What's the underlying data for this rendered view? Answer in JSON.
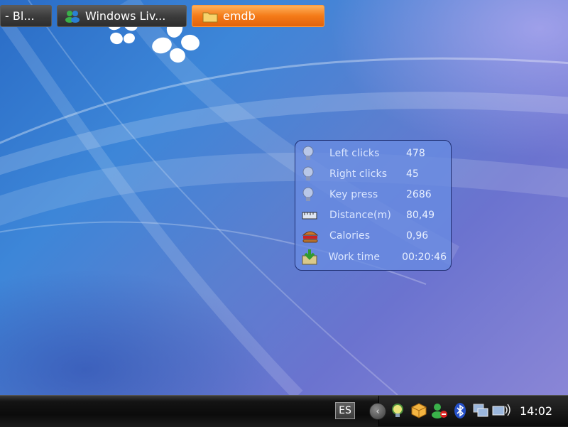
{
  "widget": {
    "rows": [
      {
        "label": "Left clicks",
        "value": "478",
        "icon": "mouse-bulb-icon"
      },
      {
        "label": "Right clicks",
        "value": "45",
        "icon": "mouse-bulb-icon"
      },
      {
        "label": "Key press",
        "value": "2686",
        "icon": "key-bulb-icon"
      },
      {
        "label": "Distance(m)",
        "value": "80,49",
        "icon": "ruler-icon"
      },
      {
        "label": "Calories",
        "value": "0,96",
        "icon": "burger-icon"
      },
      {
        "label": "Work time",
        "value": "00:20:46",
        "icon": "download-box-icon"
      }
    ]
  },
  "taskbar": {
    "tasks": [
      {
        "label": "- Bl...",
        "icon": "window-icon",
        "active": false
      },
      {
        "label": "Windows Liv...",
        "icon": "messenger-icon",
        "active": false
      },
      {
        "label": "emdb",
        "icon": "folder-icon",
        "active": true
      }
    ],
    "language": "ES",
    "tray_icons": [
      "expand-chevron-icon",
      "bulb-icon",
      "package-icon",
      "user-status-icon",
      "bluetooth-icon",
      "network-computer-icon",
      "wireless-icon"
    ],
    "clock": "14:02"
  },
  "colors": {
    "desktop": "#3d86d8",
    "widget_bg": "#698ce1",
    "active_task": "#f47a18",
    "taskbar": "#111111"
  }
}
